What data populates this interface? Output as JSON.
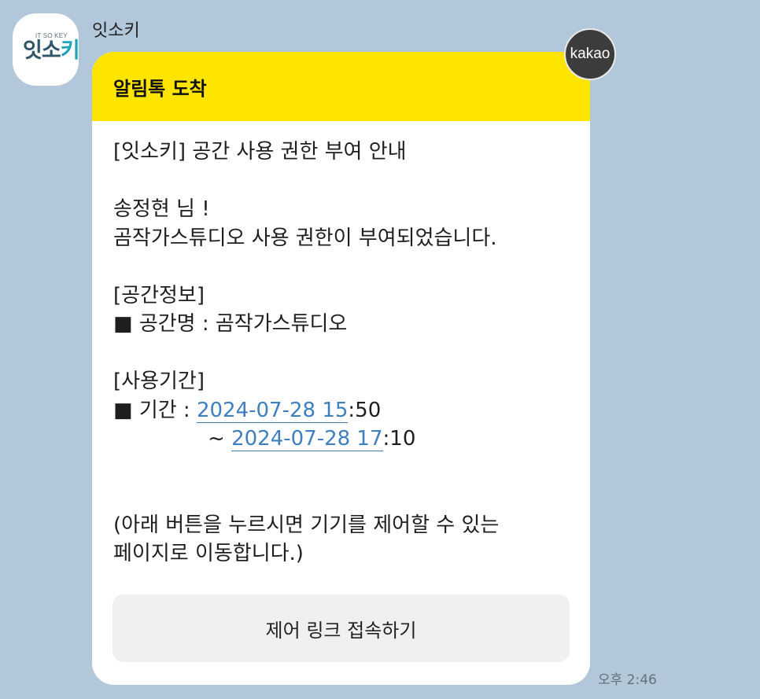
{
  "sender": {
    "name": "잇소키",
    "logo_small": "IT SO KEY",
    "logo_main_part1": "잇소",
    "logo_main_part2": "키"
  },
  "badge": {
    "label": "kakao"
  },
  "message": {
    "header_title": "알림톡 도착",
    "heading": "[잇소키] 공간 사용 권한 부여 안내",
    "greeting": "송정현 님 !",
    "granted": "곰작가스튜디오 사용 권한이 부여되었습니다.",
    "space_section": "[공간정보]",
    "space_name_label": "■ 공간명 : ",
    "space_name_value": "곰작가스튜디오",
    "period_section": "[사용기간]",
    "period_label": "■ 기간 : ",
    "period_start_link": "2024-07-28 15",
    "period_start_rest": ":50",
    "period_end_prefix": "~ ",
    "period_end_link": "2024-07-28 17",
    "period_end_rest": ":10",
    "note_line1": "(아래 버튼을 누르시면 기기를 제어할 수 있는",
    "note_line2": "페이지로 이동합니다.)"
  },
  "button": {
    "label": "제어 링크 접속하기"
  },
  "timestamp": "오후 2:46",
  "colors": {
    "background": "#b2c7d9",
    "header": "#fee500",
    "link": "#3f7fbf"
  }
}
